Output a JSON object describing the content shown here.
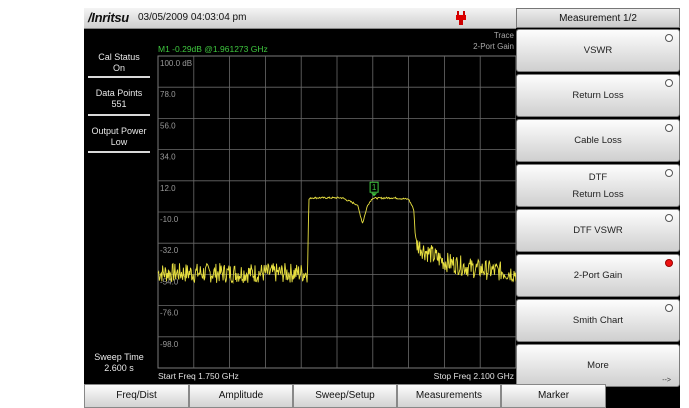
{
  "header": {
    "brand": "/Inritsu",
    "datetime": "03/05/2009 04:03:04 pm",
    "power_icon": "power-plug-icon"
  },
  "left_panel": {
    "cal_status_label": "Cal Status",
    "cal_status_value": "On",
    "data_points_label": "Data Points",
    "data_points_value": "551",
    "output_power_label": "Output Power",
    "output_power_value": "Low",
    "sweep_time_label": "Sweep Time",
    "sweep_time_value": "2.600 s"
  },
  "plot": {
    "marker_readout": "M1 -0.29dB @1.961273 GHz",
    "trace_label_1": "Trace",
    "trace_label_2": "2-Port Gain",
    "marker_number": "1",
    "start_freq": "Start Freq 1.750 GHz",
    "stop_freq": "Stop Freq 2.100 GHz",
    "y_ticks": [
      "100.0 dB",
      "78.0",
      "56.0",
      "34.0",
      "12.0",
      "-10.0",
      "-32.0",
      "-54.0",
      "-76.0",
      "-98.0"
    ],
    "trace_color": "#e8e040",
    "marker_color": "#3fc83f"
  },
  "chart_data": {
    "type": "line",
    "x_range_ghz": [
      1.75,
      2.1
    ],
    "ylim": [
      -120,
      100
    ],
    "y_ticks": [
      100,
      78,
      56,
      34,
      12,
      -10,
      -32,
      -54,
      -76,
      -98
    ],
    "series": [
      {
        "x": [
          1.75,
          1.8,
          1.85,
          1.896,
          1.8975,
          1.9,
          1.93,
          1.945,
          1.95,
          1.955,
          1.96,
          1.9613,
          1.98,
          1.995,
          2.0,
          2.002,
          2.01,
          2.03,
          2.06,
          2.1
        ],
        "y": [
          -53,
          -53,
          -53,
          -53,
          -1,
          0,
          0,
          -5,
          -18,
          -5,
          0,
          -0.29,
          0,
          -1,
          -8,
          -32,
          -37,
          -45,
          -50,
          -53
        ]
      }
    ],
    "marker": {
      "label": "M1",
      "x": 1.961273,
      "y": -0.29
    }
  },
  "menu": {
    "title": "Measurement 1/2",
    "items": [
      {
        "label": "VSWR",
        "selected": false
      },
      {
        "label": "Return Loss",
        "selected": false
      },
      {
        "label": "Cable Loss",
        "selected": false
      },
      {
        "label": "DTF",
        "label2": "Return Loss",
        "selected": false
      },
      {
        "label": "DTF VSWR",
        "selected": false
      },
      {
        "label": "2-Port Gain",
        "selected": true
      },
      {
        "label": "Smith Chart",
        "selected": false
      },
      {
        "label": "More",
        "selected": false
      }
    ],
    "more_arrow": "-->"
  },
  "tabs": [
    "Freq/Dist",
    "Amplitude",
    "Sweep/Setup",
    "Measurements",
    "Marker"
  ]
}
